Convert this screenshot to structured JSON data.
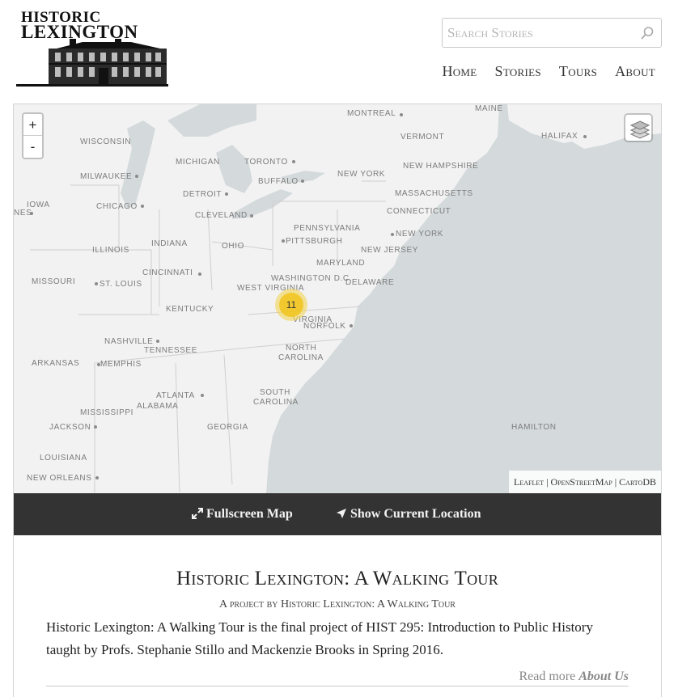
{
  "logo": {
    "line1": "HISTORIC",
    "line2": "LEXINGTON"
  },
  "search": {
    "placeholder": "Search Stories",
    "value": ""
  },
  "nav": [
    {
      "label": "Home"
    },
    {
      "label": "Stories"
    },
    {
      "label": "Tours"
    },
    {
      "label": "About"
    }
  ],
  "map": {
    "zoom_in": "+",
    "zoom_out": "-",
    "cluster_count": "11",
    "labels": {
      "maine": "Maine",
      "montreal": "Montreal",
      "vermont": "Vermont",
      "halifax": "Halifax",
      "wisconsin": "Wisconsin",
      "michigan": "Michigan",
      "toronto": "Toronto",
      "buffalo": "Buffalo",
      "new_york_state": "New York",
      "new_hampshire": "New Hampshire",
      "milwaukee": "Milwaukee",
      "detroit": "Detroit",
      "massachusetts": "Massachusetts",
      "iowa": "Iowa",
      "nes": "nes",
      "chicago": "Chicago",
      "cleveland": "Cleveland",
      "connecticut": "Connecticut",
      "pennsylvania": "Pennsylvania",
      "pittsburgh": "Pittsburgh",
      "new_york_city": "New York",
      "illinois": "Illinois",
      "indiana": "Indiana",
      "ohio": "Ohio",
      "new_jersey": "New Jersey",
      "maryland": "Maryland",
      "cincinnati": "Cincinnati",
      "missouri": "Missouri",
      "st_louis": "St. Louis",
      "washington": "Washington D.C.",
      "west_virginia": "West Virginia",
      "delaware": "Delaware",
      "kentucky": "Kentucky",
      "virginia": "Virginia",
      "norfolk": "Norfolk",
      "nashville": "Nashville",
      "tennessee": "Tennessee",
      "north_carolina_1": "North",
      "north_carolina_2": "Carolina",
      "arkansas": "Arkansas",
      "memphis": "Memphis",
      "atlanta": "Atlanta",
      "south_carolina_1": "South",
      "south_carolina_2": "Carolina",
      "alabama": "Alabama",
      "mississippi": "Mississippi",
      "georgia": "Georgia",
      "jackson": "Jackson",
      "hamilton": "Hamilton",
      "louisiana": "Louisiana",
      "new_orleans": "New Orleans"
    },
    "attribution": {
      "leaflet": "Leaflet",
      "osm": "OpenStreetMap",
      "carto": "CartoDB",
      "sep": "|"
    }
  },
  "map_bar": {
    "fullscreen": "Fullscreen Map",
    "location": "Show Current Location"
  },
  "project": {
    "title": "Historic Lexington: A Walking Tour",
    "byline": "A project by Historic Lexington: A Walking Tour",
    "description": "Historic Lexington: A Walking Tour is the final project of HIST 295: Introduction to Public History taught by Profs. Stephanie Stillo and Mackenzie Brooks in Spring 2016.",
    "read_more": "Read more",
    "read_more_link": "About Us"
  },
  "colors": {
    "water": "#d4dadc",
    "land": "#f2f2f2",
    "bar": "#333333",
    "cluster": "#f0c20c"
  }
}
